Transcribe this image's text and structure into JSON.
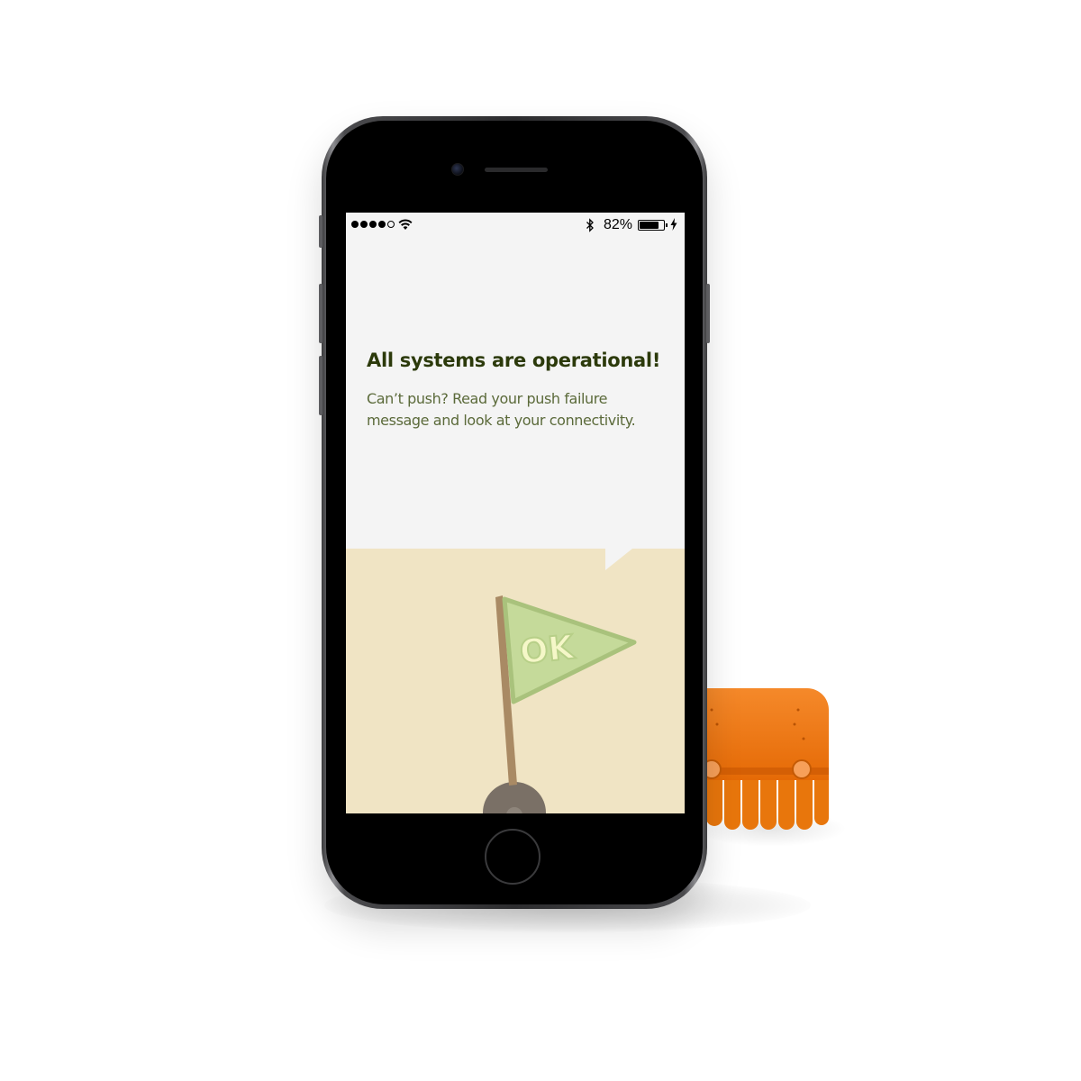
{
  "status_bar": {
    "signal_bars_filled": 4,
    "signal_bars_total": 5,
    "battery_percent_label": "82%",
    "battery_level": 0.82,
    "charging": true,
    "icons": [
      "signal-dots-icon",
      "wifi-icon",
      "bluetooth-icon",
      "battery-icon",
      "charging-bolt-icon"
    ]
  },
  "message": {
    "headline": "All systems are operational!",
    "body": "Can’t push? Read your push failure message and look at your connectivity."
  },
  "illustration": {
    "flag_text": "OK",
    "colors": {
      "panel": "#f0e4c4",
      "flag": "#c5da9a",
      "flag_border": "#a9c27c",
      "flag_text": "#f5f7c8",
      "pole": "#a98a64"
    }
  },
  "colors": {
    "screen_background": "#f4f4f4",
    "headline": "#2c3a0b",
    "body_text": "#5b6a3a",
    "mascot": "#f07a10"
  }
}
